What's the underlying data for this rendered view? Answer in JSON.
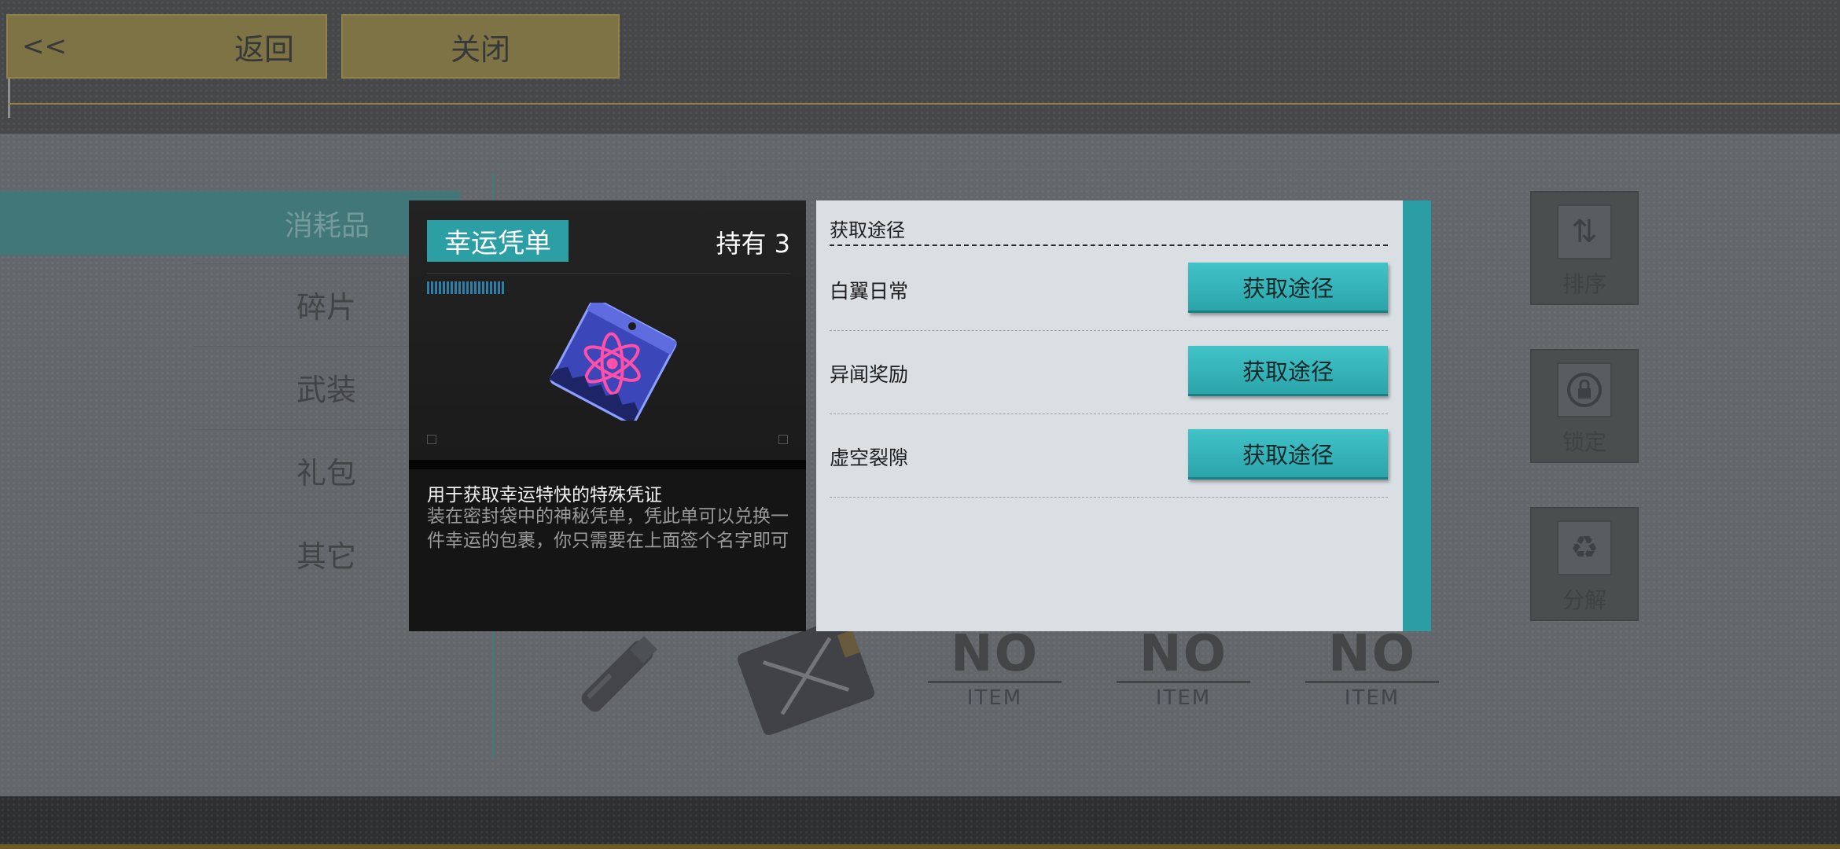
{
  "nav": {
    "back_chevron": "<<",
    "back_label": "返回",
    "close_label": "关闭"
  },
  "categories": {
    "active": "消耗品",
    "items": [
      "碎片",
      "武装",
      "礼包",
      "其它"
    ]
  },
  "grid": {
    "no_item_big": "NO",
    "no_item_small": "ITEM"
  },
  "side_buttons": [
    {
      "label": "排序",
      "icon": "sort-icon"
    },
    {
      "label": "锁定",
      "icon": "lock-icon"
    },
    {
      "label": "分解",
      "icon": "recycle-icon"
    }
  ],
  "item": {
    "name": "幸运凭单",
    "owned": "持有 3",
    "description_title": "用于获取幸运特快的特殊凭证",
    "description_body": "装在密封袋中的神秘凭单，凭此单可以兑换一件幸运的包裹，你只需要在上面签个名字即可"
  },
  "sources": {
    "title": "获取途径",
    "rows": [
      {
        "label": "白翼日常",
        "button": "获取途径"
      },
      {
        "label": "异闻奖励",
        "button": "获取途径"
      },
      {
        "label": "虚空裂隙",
        "button": "获取途径"
      }
    ]
  },
  "colors": {
    "accent": "#2c9fa4",
    "gold": "#7a6a2a"
  }
}
